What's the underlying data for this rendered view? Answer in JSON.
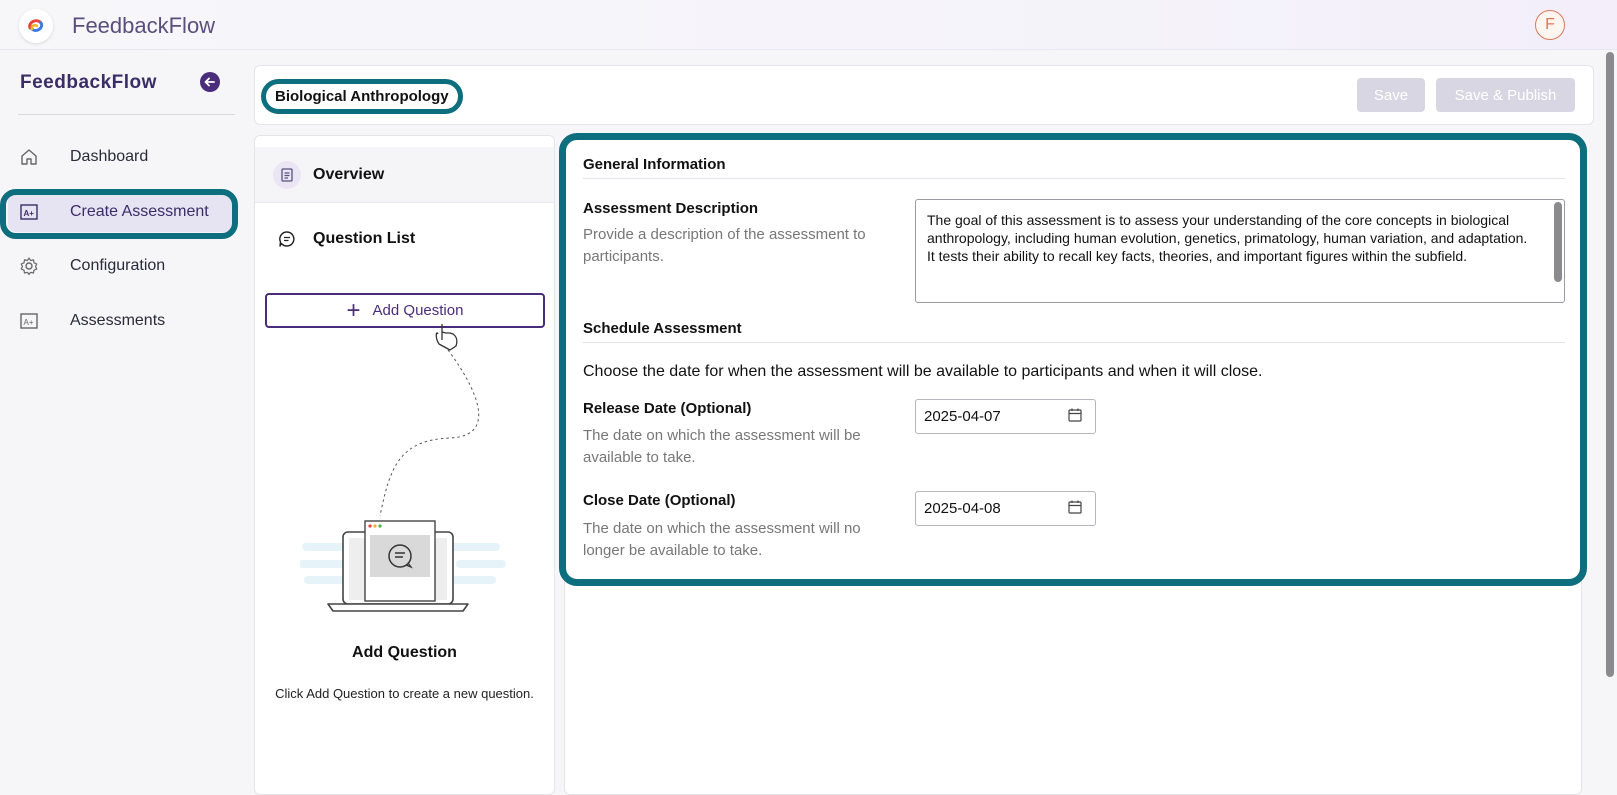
{
  "app": {
    "title": "FeedbackFlow",
    "avatar_letter": "F"
  },
  "sidebar": {
    "brand": "FeedbackFlow",
    "items": [
      {
        "label": "Dashboard",
        "icon": "home-icon",
        "active": false
      },
      {
        "label": "Create Assessment",
        "icon": "assessment-create-icon",
        "active": true
      },
      {
        "label": "Configuration",
        "icon": "gear-icon",
        "active": false
      },
      {
        "label": "Assessments",
        "icon": "assessments-icon",
        "active": false
      }
    ]
  },
  "header": {
    "assessment_title": "Biological Anthropology",
    "save_label": "Save",
    "save_publish_label": "Save & Publish"
  },
  "question_panel": {
    "tabs": [
      {
        "label": "Overview",
        "icon": "document-icon",
        "active": true
      },
      {
        "label": "Question List",
        "icon": "chat-list-icon",
        "active": false
      }
    ],
    "add_button_label": "Add Question",
    "empty_title": "Add Question",
    "empty_text": "Click Add Question to create a new question."
  },
  "form": {
    "general_heading": "General Information",
    "description_label": "Assessment Description",
    "description_help": "Provide a description of the assessment to participants.",
    "description_value": "The goal of this assessment is to assess your understanding of the core concepts in biological anthropology, including human evolution, genetics, primatology, human variation, and adaptation. It tests their ability to recall key facts, theories, and important figures within the subfield.",
    "schedule_heading": "Schedule Assessment",
    "schedule_text": "Choose the date for when the assessment will be available to participants and when it will close.",
    "release_label": "Release Date (Optional)",
    "release_help": "The date on which the assessment will be available to take.",
    "release_value": "2025-04-07",
    "close_label": "Close Date (Optional)",
    "close_help": "The date on which the assessment will no longer be available to take.",
    "close_value": "2025-04-08"
  },
  "colors": {
    "accent": "#4a2d7a",
    "highlight": "#0d6e7d",
    "disabled_button": "#d8d6e2"
  }
}
